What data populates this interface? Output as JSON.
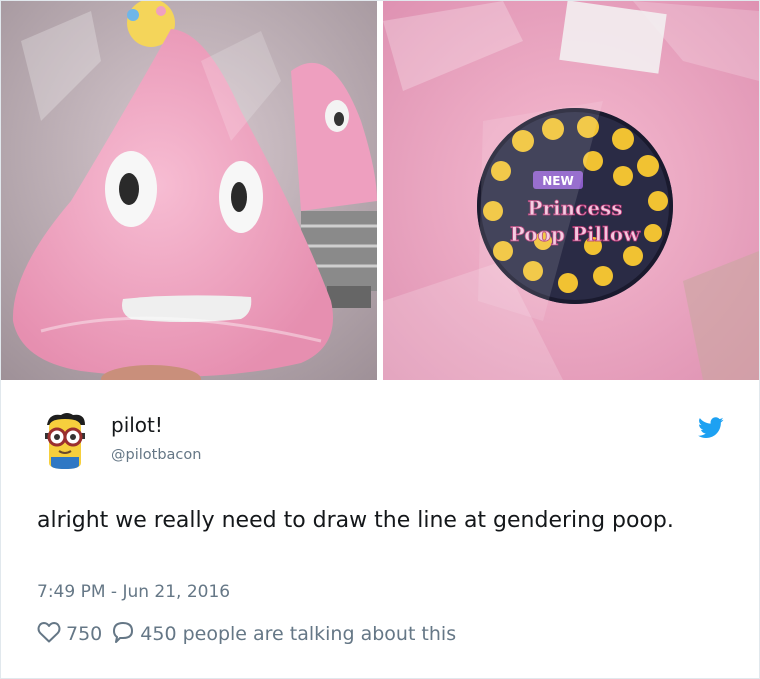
{
  "photos": {
    "left": {
      "icon": "pink-poop-pillow-photo-icon"
    },
    "right": {
      "icon": "product-label-photo-icon",
      "label_line1": "Princess",
      "label_line2": "Poop Pillow",
      "badge": "NEW"
    }
  },
  "tweet": {
    "display_name": "pilot!",
    "handle": "@pilotbacon",
    "text": "alright we really need to draw the line at gendering poop.",
    "timestamp": "7:49 PM - Jun 21, 2016",
    "likes": "750",
    "replies_talking": "450 people are talking about this"
  },
  "icons": {
    "avatar": "minion-avatar-icon",
    "brand": "twitter-bird-icon",
    "like": "heart-icon",
    "reply": "speech-bubble-icon"
  },
  "colors": {
    "pink": "#f2a9c4",
    "twitter_blue": "#1da1f2",
    "text": "#14171a",
    "muted": "#657786"
  }
}
